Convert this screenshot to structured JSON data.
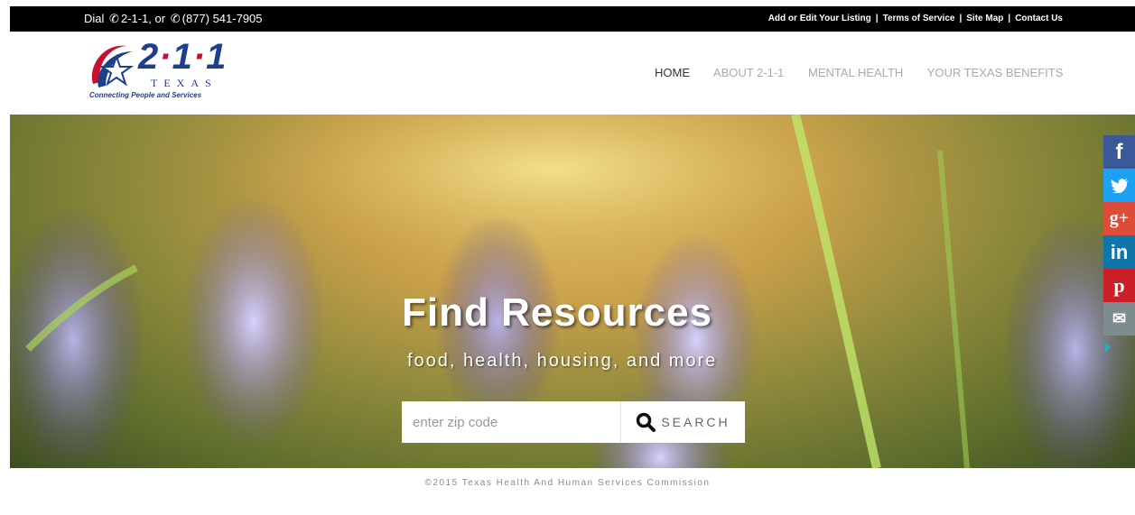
{
  "topbar": {
    "dial_prefix": "Dial",
    "dial_number_1": "2-1-1, or",
    "dial_number_2": "(877) 541-7905",
    "links": [
      "Add or Edit Your Listing",
      "Terms of Service",
      "Site Map",
      "Contact Us"
    ]
  },
  "logo": {
    "number_a": "2",
    "number_b": "1",
    "number_c": "1",
    "state": "TEXAS",
    "tagline": "Connecting People and Services"
  },
  "nav": {
    "items": [
      "HOME",
      "ABOUT 2-1-1",
      "MENTAL HEALTH",
      "YOUR TEXAS BENEFITS"
    ],
    "active": "HOME"
  },
  "hero": {
    "title": "Find Resources",
    "subtitle": "food, health, housing, and more",
    "search_placeholder": "enter zip code",
    "search_button": "SEARCH"
  },
  "social": {
    "buttons": [
      {
        "name": "facebook",
        "glyph": "f",
        "color": "#3b5998"
      },
      {
        "name": "twitter",
        "glyph": "t",
        "color": "#1da1f2"
      },
      {
        "name": "google-plus",
        "glyph": "g+",
        "color": "#dd4b39"
      },
      {
        "name": "linkedin",
        "glyph": "in",
        "color": "#0e76a8"
      },
      {
        "name": "pinterest",
        "glyph": "p",
        "color": "#cb2027"
      },
      {
        "name": "email",
        "glyph": "✉",
        "color": "#7f8c8d"
      }
    ]
  },
  "footer": {
    "copyright": "©2015 Texas Health And Human Services Commission"
  },
  "colors": {
    "brand_blue": "#1e3f8c",
    "brand_red": "#c8102e",
    "topbar": "#000000"
  }
}
